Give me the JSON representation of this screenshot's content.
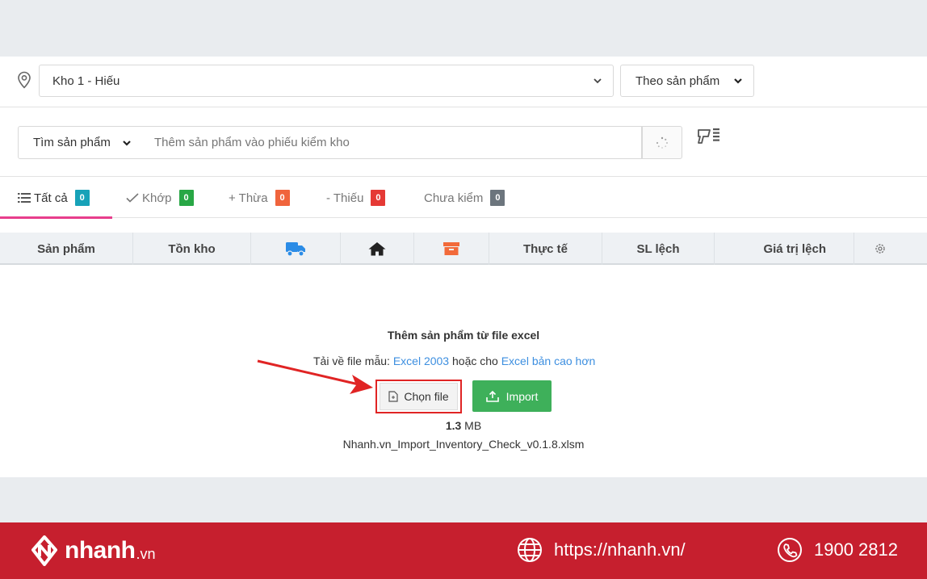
{
  "warehouse": {
    "selected": "Kho 1 - Hiếu"
  },
  "mode": {
    "selected": "Theo sản phẩm"
  },
  "search": {
    "type_selected": "Tìm sản phẩm",
    "placeholder": "Thêm sản phẩm vào phiếu kiểm kho"
  },
  "tabs": [
    {
      "label": "Tất cả",
      "count": "0",
      "color": "#17a2b8"
    },
    {
      "label": "Khớp",
      "count": "0",
      "color": "#28a745"
    },
    {
      "label": "+ Thừa",
      "count": "0",
      "color": "#f0643c"
    },
    {
      "label": "- Thiếu",
      "count": "0",
      "color": "#e53935"
    },
    {
      "label": "Chưa kiểm",
      "count": "0",
      "color": "#6c757d"
    }
  ],
  "table": {
    "headers": {
      "product": "Sản phẩm",
      "stock": "Tồn kho",
      "shipping_icon": "truck-icon",
      "home_icon": "home-icon",
      "archive_icon": "archive-icon",
      "actual": "Thực tế",
      "diff_qty": "SL lệch",
      "diff_value": "Giá trị lệch",
      "settings_icon": "gear-icon"
    }
  },
  "import": {
    "title": "Thêm sản phẩm từ file excel",
    "download_prefix": "Tải về file mẫu:",
    "link_excel2003": "Excel 2003",
    "download_middle": "hoặc cho",
    "link_newer": "Excel bản cao hơn",
    "choose_label": "Chọn file",
    "import_label": "Import",
    "size_value": "1.3",
    "size_unit": "MB",
    "file_name": "Nhanh.vn_Import_Inventory_Check_v0.1.8.xlsm"
  },
  "footer": {
    "brand": "nhanh",
    "brand_tld": ".vn",
    "website": "https://nhanh.vn/",
    "phone": "1900 2812"
  },
  "colors": {
    "accent_pink": "#e83e8c",
    "link_blue": "#3d8fe0",
    "import_green": "#3eb05a",
    "highlight_red": "#e02424",
    "footer_red": "#c61f2e",
    "truck_blue": "#2b8ce6",
    "archive_orange": "#f26a3a"
  }
}
